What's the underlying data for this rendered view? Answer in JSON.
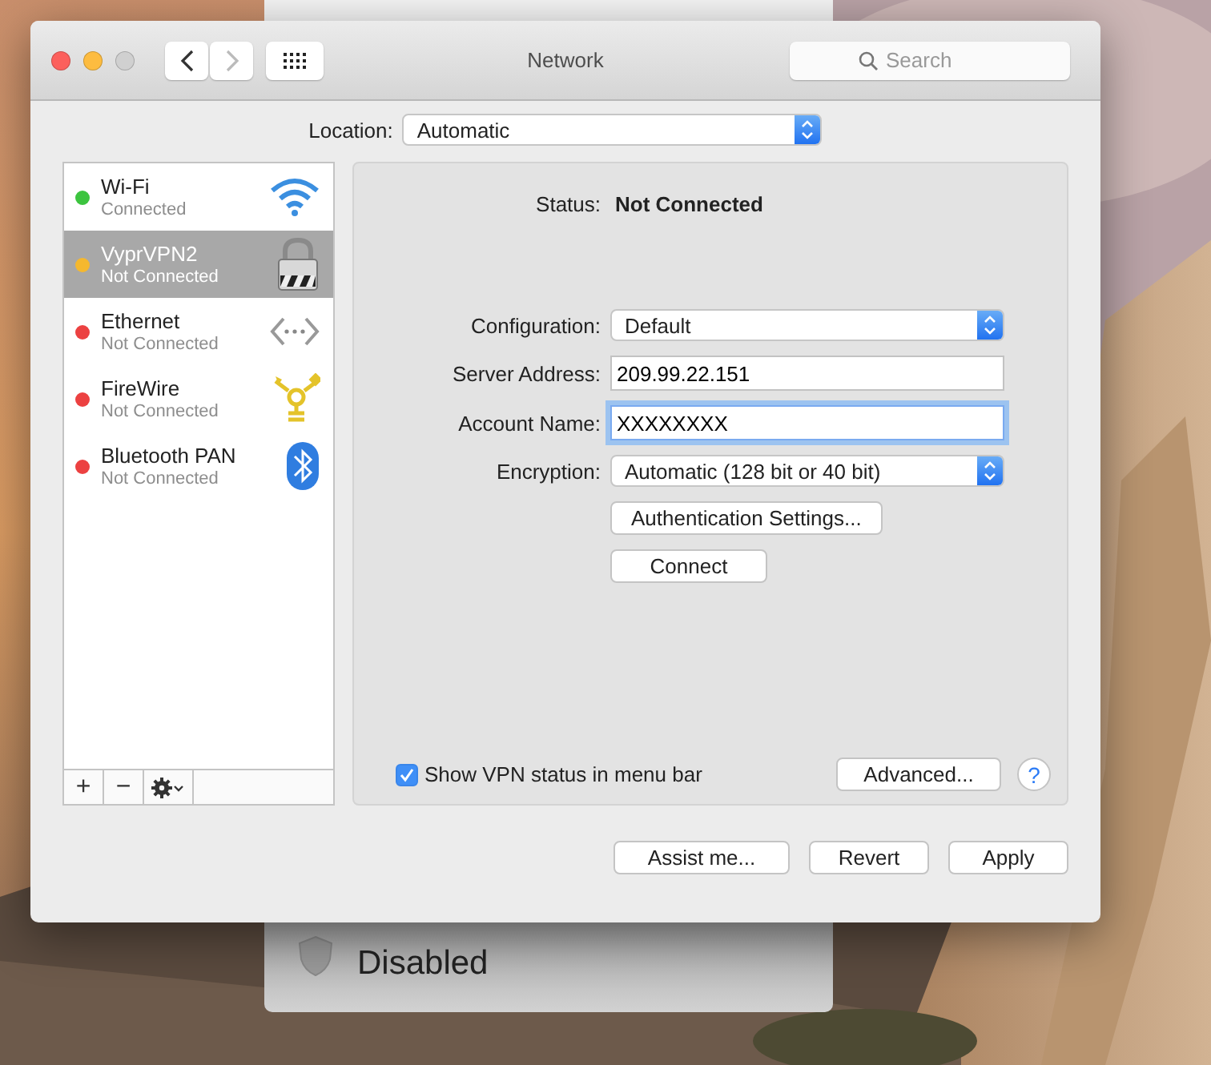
{
  "background_window": {
    "status": "Disabled"
  },
  "window": {
    "title": "Network",
    "search": {
      "placeholder": "Search"
    }
  },
  "location": {
    "label": "Location:",
    "value": "Automatic"
  },
  "services": [
    {
      "name": "Wi-Fi",
      "status": "Connected",
      "color": "#3cc43f",
      "kind": "wifi",
      "selected": false
    },
    {
      "name": "VyprVPN2",
      "status": "Not Connected",
      "color": "#f5b82e",
      "kind": "vpn",
      "selected": true
    },
    {
      "name": "Ethernet",
      "status": "Not Connected",
      "color": "#ec4141",
      "kind": "ethernet",
      "selected": false
    },
    {
      "name": "FireWire",
      "status": "Not Connected",
      "color": "#ec4141",
      "kind": "firewire",
      "selected": false
    },
    {
      "name": "Bluetooth PAN",
      "status": "Not Connected",
      "color": "#ec4141",
      "kind": "bluetooth",
      "selected": false
    }
  ],
  "sidebar_toolbar": {
    "add": "+",
    "remove": "−"
  },
  "detail": {
    "status_label": "Status:",
    "status_value": "Not Connected",
    "fields": [
      {
        "kind": "popup",
        "label": "Configuration:",
        "value": "Default"
      },
      {
        "kind": "text",
        "label": "Server Address:",
        "value": "209.99.22.151",
        "focused": false
      },
      {
        "kind": "text",
        "label": "Account Name:",
        "value": "XXXXXXXX",
        "focused": true
      },
      {
        "kind": "popup",
        "label": "Encryption:",
        "value": "Automatic (128 bit or 40 bit)"
      }
    ],
    "buttons": [
      "Authentication Settings...",
      "Connect"
    ],
    "show_status": {
      "label": "Show VPN status in menu bar",
      "checked": true
    },
    "advanced": "Advanced...",
    "help": "?"
  },
  "buttons": [
    "Assist me...",
    "Revert",
    "Apply"
  ]
}
